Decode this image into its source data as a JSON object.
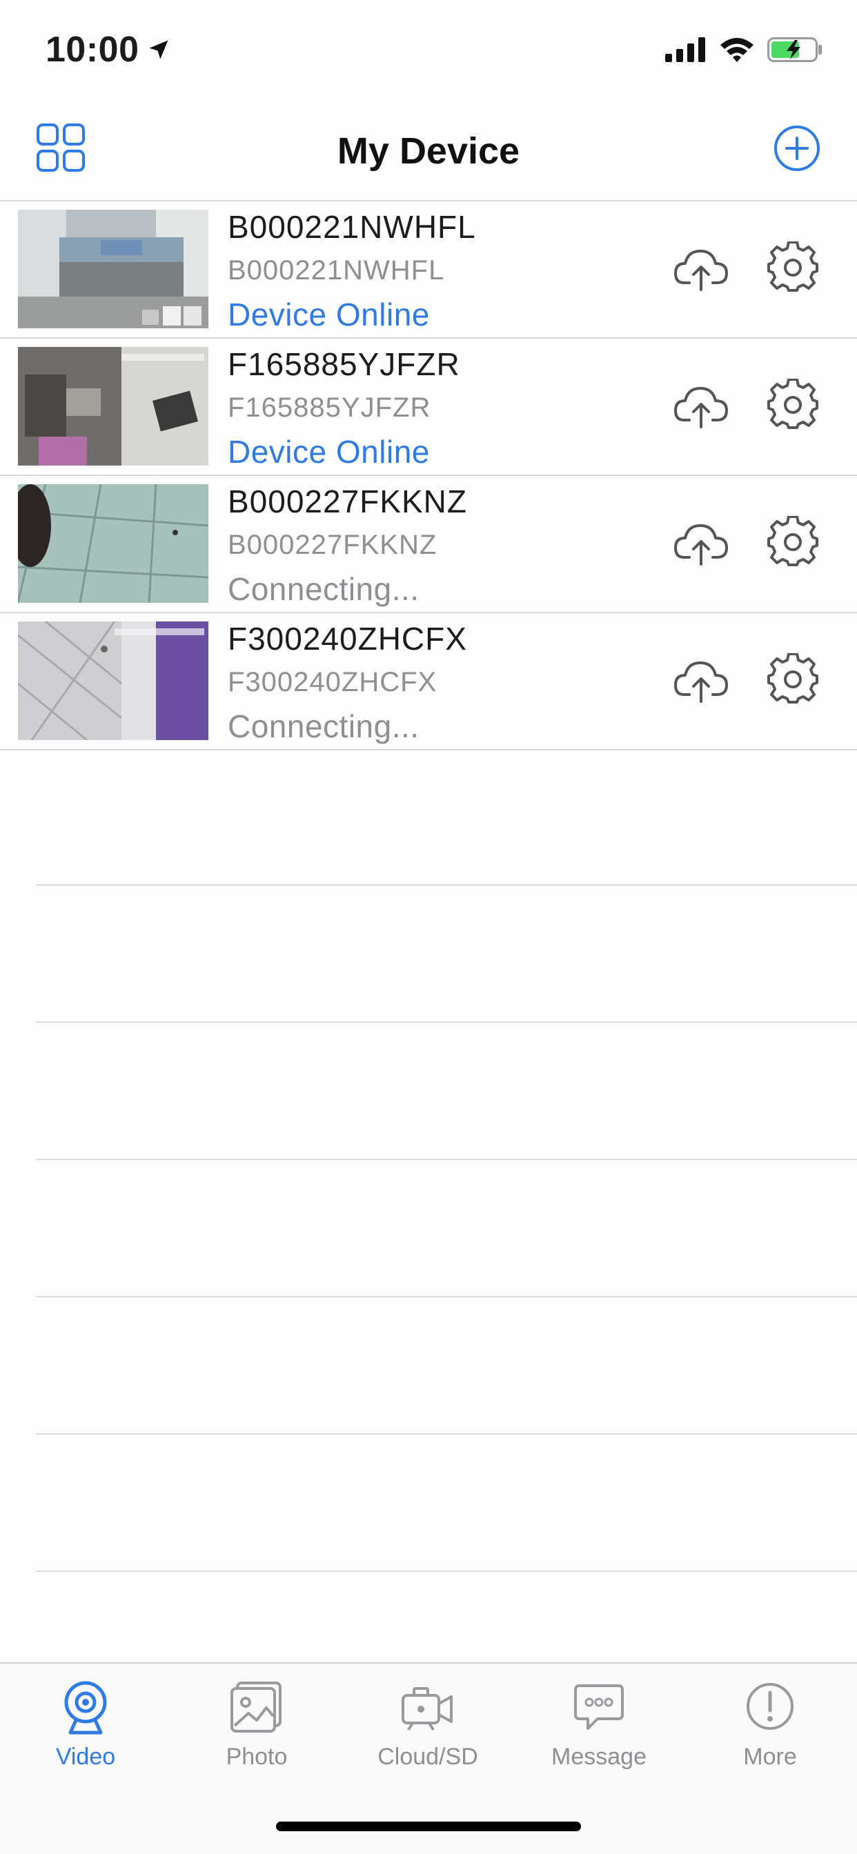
{
  "status_bar": {
    "time": "10:00",
    "icons": [
      "location-arrow-icon",
      "cellular-signal-icon",
      "wifi-icon",
      "battery-charging-icon"
    ]
  },
  "nav": {
    "title": "My Device",
    "left_icon": "grid-view-icon",
    "right_icon": "add-circle-icon"
  },
  "devices": [
    {
      "name": "B000221NWHFL",
      "id": "B000221NWHFL",
      "status": "Device Online",
      "status_type": "online"
    },
    {
      "name": "F165885YJFZR",
      "id": "F165885YJFZR",
      "status": "Device Online",
      "status_type": "online"
    },
    {
      "name": "B000227FKKNZ",
      "id": "B000227FKKNZ",
      "status": "Connecting...",
      "status_type": "connecting"
    },
    {
      "name": "F300240ZHCFX",
      "id": "F300240ZHCFX",
      "status": "Connecting...",
      "status_type": "connecting"
    }
  ],
  "tabs": [
    {
      "label": "Video",
      "icon": "webcam-icon",
      "active": true
    },
    {
      "label": "Photo",
      "icon": "photo-icon",
      "active": false
    },
    {
      "label": "Cloud/SD",
      "icon": "video-camera-icon",
      "active": false
    },
    {
      "label": "Message",
      "icon": "message-bubble-icon",
      "active": false
    },
    {
      "label": "More",
      "icon": "exclamation-circle-icon",
      "active": false
    }
  ],
  "colors": {
    "accent": "#2f7be4",
    "secondary_text": "#8e8e93",
    "icon_gray": "#555555"
  }
}
